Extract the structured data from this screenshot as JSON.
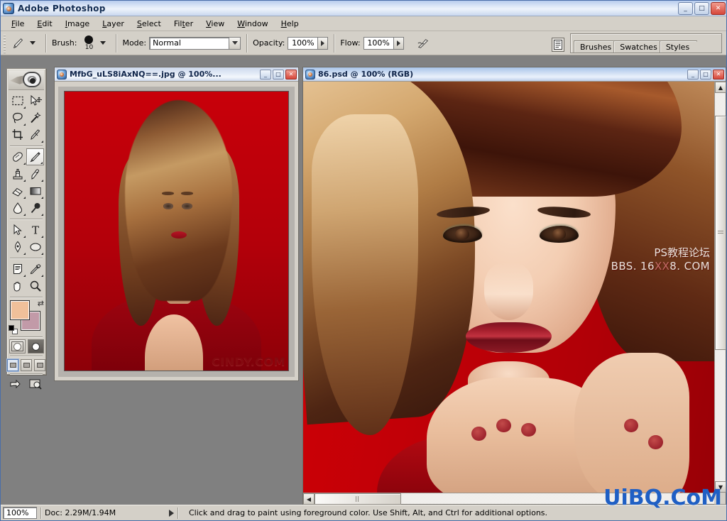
{
  "app": {
    "title": "Adobe Photoshop",
    "icon": "photoshop-icon",
    "window_buttons": {
      "minimize": "_",
      "maximize": "□",
      "close": "✕"
    }
  },
  "menu": {
    "items": [
      {
        "label": "File",
        "accel": "F"
      },
      {
        "label": "Edit",
        "accel": "E"
      },
      {
        "label": "Image",
        "accel": "I"
      },
      {
        "label": "Layer",
        "accel": "L"
      },
      {
        "label": "Select",
        "accel": "S"
      },
      {
        "label": "Filter",
        "accel": "t"
      },
      {
        "label": "View",
        "accel": "V"
      },
      {
        "label": "Window",
        "accel": "W"
      },
      {
        "label": "Help",
        "accel": "H"
      }
    ]
  },
  "options_bar": {
    "tool_preset_icon": "brush-tool-icon",
    "brush_label": "Brush:",
    "brush_size": "10",
    "mode_label": "Mode:",
    "mode_value": "Normal",
    "opacity_label": "Opacity:",
    "opacity_value": "100%",
    "flow_label": "Flow:",
    "flow_value": "100%",
    "airbrush_icon": "airbrush-icon",
    "palette_well_icon": "palette-well-icon"
  },
  "palette_well": {
    "tabs": [
      {
        "label": "Brushes"
      },
      {
        "label": "Swatches"
      },
      {
        "label": "Styles"
      }
    ]
  },
  "toolbox": {
    "banner_icon": "photoshop-eye-feather-banner",
    "tools": [
      {
        "name": "marquee-tool",
        "glyph": "marquee",
        "has_flyout": true
      },
      {
        "name": "move-tool",
        "glyph": "move",
        "has_flyout": false
      },
      {
        "name": "lasso-tool",
        "glyph": "lasso",
        "has_flyout": true
      },
      {
        "name": "magic-wand-tool",
        "glyph": "wand",
        "has_flyout": false
      },
      {
        "name": "crop-tool",
        "glyph": "crop",
        "has_flyout": false
      },
      {
        "name": "slice-tool",
        "glyph": "slice",
        "has_flyout": true
      },
      {
        "name": "healing-brush-tool",
        "glyph": "healing",
        "has_flyout": true
      },
      {
        "name": "brush-tool",
        "glyph": "brush",
        "has_flyout": true,
        "selected": true
      },
      {
        "name": "clone-stamp-tool",
        "glyph": "stamp",
        "has_flyout": true
      },
      {
        "name": "history-brush-tool",
        "glyph": "historybrush",
        "has_flyout": true
      },
      {
        "name": "eraser-tool",
        "glyph": "eraser",
        "has_flyout": true
      },
      {
        "name": "gradient-tool",
        "glyph": "gradient",
        "has_flyout": true
      },
      {
        "name": "blur-tool",
        "glyph": "blur",
        "has_flyout": true
      },
      {
        "name": "dodge-tool",
        "glyph": "dodge",
        "has_flyout": true
      },
      {
        "name": "path-selection-tool",
        "glyph": "pathselect",
        "has_flyout": true
      },
      {
        "name": "type-tool",
        "glyph": "type",
        "has_flyout": true
      },
      {
        "name": "pen-tool",
        "glyph": "pen",
        "has_flyout": true
      },
      {
        "name": "shape-tool",
        "glyph": "ellipse",
        "has_flyout": true
      },
      {
        "name": "notes-tool",
        "glyph": "notes",
        "has_flyout": true
      },
      {
        "name": "eyedropper-tool",
        "glyph": "eyedropper",
        "has_flyout": true
      },
      {
        "name": "hand-tool",
        "glyph": "hand",
        "has_flyout": false
      },
      {
        "name": "zoom-tool",
        "glyph": "zoom",
        "has_flyout": false
      }
    ],
    "colors": {
      "foreground": "#f0c09a",
      "background": "#c29aa8",
      "swap_icon": "swap-colors-icon",
      "default_icon": "default-colors-icon"
    },
    "mask_modes": [
      {
        "name": "standard-mode",
        "selected": true
      },
      {
        "name": "quick-mask-mode",
        "selected": false
      }
    ],
    "screen_modes": [
      {
        "name": "standard-screen-mode",
        "selected": true
      },
      {
        "name": "full-screen-with-menubar-mode",
        "selected": false
      },
      {
        "name": "full-screen-mode",
        "selected": false
      }
    ],
    "jump_buttons": [
      {
        "name": "jump-to-imageready-button"
      },
      {
        "name": "jump-to-preview-button"
      }
    ]
  },
  "documents": [
    {
      "id": "doc-photo",
      "title": "MfbG_uLS8iAxNQ==.jpg @ 100%...",
      "active": false,
      "watermark": "CINDY.COM",
      "buttons": {
        "minimize": "_",
        "maximize": "□",
        "close": "✕"
      }
    },
    {
      "id": "doc-painting",
      "title": "86.psd @ 100%  (RGB)",
      "active": true,
      "watermark_line1": "PS教程论坛",
      "watermark_line2a": "BBS. 16",
      "watermark_line2b": "XX",
      "watermark_line2c": "8. COM",
      "buttons": {
        "minimize": "_",
        "maximize": "□",
        "close": "✕"
      }
    }
  ],
  "status_bar": {
    "zoom": "100%",
    "doc_info": "Doc: 2.29M/1.94M",
    "hint": "Click and drag to paint using foreground color.  Use Shift, Alt, and Ctrl for additional options."
  },
  "overlay_watermark": "UiBQ.CoM",
  "colors": {
    "window_bg": "#808080",
    "chrome": "#d4d0c8",
    "title_active": "#a8c4e8",
    "canvas_red": "#c10007",
    "accent_blue": "#1f5fc4"
  }
}
